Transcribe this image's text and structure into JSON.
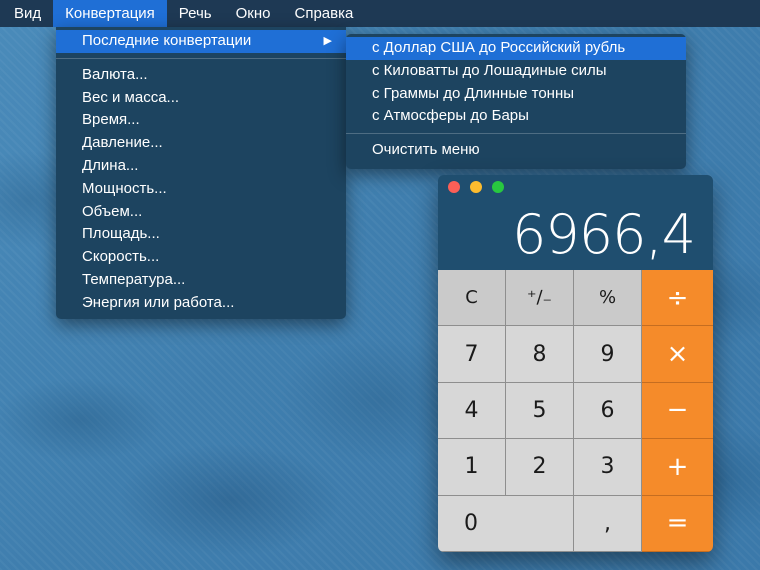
{
  "menubar": {
    "items": [
      "Вид",
      "Конвертация",
      "Речь",
      "Окно",
      "Справка"
    ],
    "active_index": 1
  },
  "convert_menu": {
    "recent_label": "Последние конвертации",
    "submenu_arrow": "▶",
    "items": [
      "Валюта...",
      "Вес и масса...",
      "Время...",
      "Давление...",
      "Длина...",
      "Мощность...",
      "Объем...",
      "Площадь...",
      "Скорость...",
      "Температура...",
      "Энергия или работа..."
    ]
  },
  "recent_menu": {
    "items": [
      "с Доллар США до Российский рубль",
      "с Киловатты до Лошадиные силы",
      "с Граммы до Длинные тонны",
      "с Атмосферы до Бары"
    ],
    "clear_label": "Очистить меню"
  },
  "calculator": {
    "display": "6966,4",
    "keys": {
      "clear": "C",
      "sign": "⁺∕₋",
      "percent": "%",
      "divide": "÷",
      "seven": "7",
      "eight": "8",
      "nine": "9",
      "multiply": "×",
      "four": "4",
      "five": "5",
      "six": "6",
      "minus": "−",
      "one": "1",
      "two": "2",
      "three": "3",
      "plus": "+",
      "zero": "0",
      "comma": ",",
      "equals": "="
    }
  },
  "colors": {
    "menu_bg": "#1d4460",
    "highlight": "#1f6fd6",
    "operator": "#f58b2a"
  }
}
